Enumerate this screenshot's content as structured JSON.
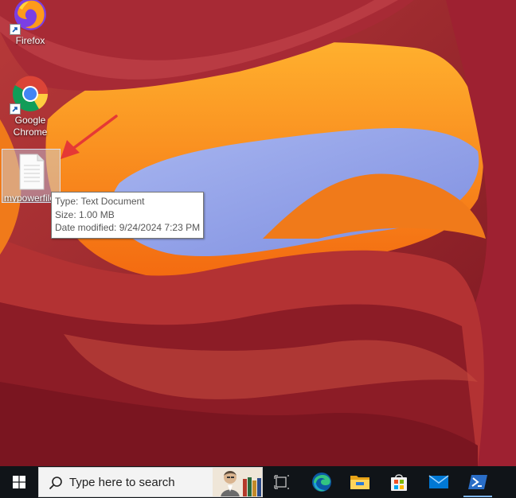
{
  "desktop": {
    "icons": [
      {
        "name": "firefox",
        "label": "Firefox"
      },
      {
        "name": "chrome",
        "label": "Google Chrome"
      },
      {
        "name": "file",
        "label": "mypowerfile"
      }
    ]
  },
  "tooltip": {
    "type": "Type: Text Document",
    "size": "Size: 1.00 MB",
    "date_modified": "Date modified: 9/24/2024 7:23 PM"
  },
  "taskbar": {
    "search_placeholder": "Type here to search",
    "buttons": [
      "start-icon",
      "task-view-icon",
      "edge-icon",
      "file-explorer-icon",
      "microsoft-store-icon",
      "mail-icon",
      "powershell-icon"
    ]
  },
  "colors": {
    "taskbar": "#101418",
    "arrow": "#e53935"
  }
}
